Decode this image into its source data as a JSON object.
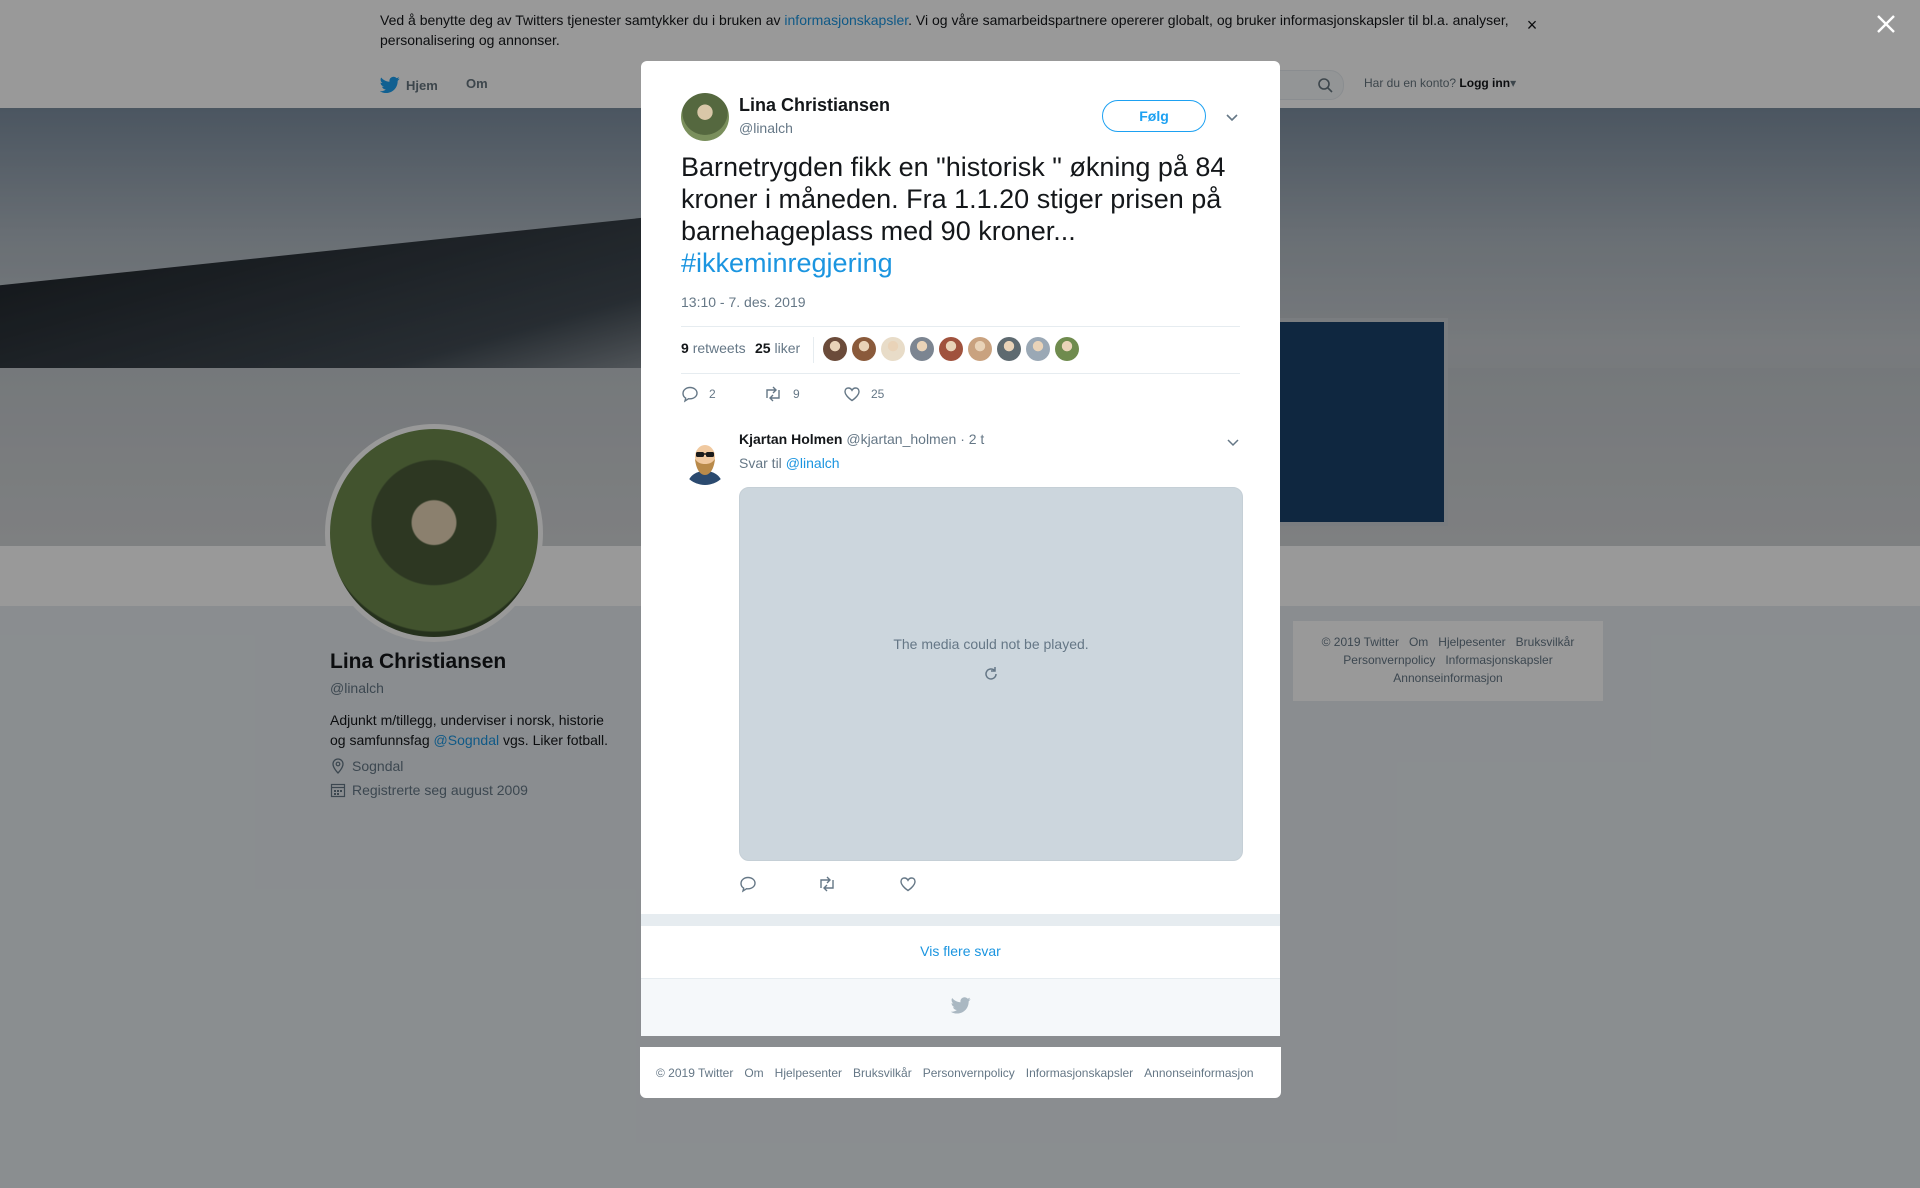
{
  "cookie_bar": {
    "text_before": "Ved å benytte deg av Twitters tjenester samtykker du i bruken av ",
    "link": "informasjonskapsler",
    "text_after": ". Vi og våre samarbeidspartnere opererer globalt, og bruker informasjonskapsler til bl.a. analyser, personalisering og annonser.",
    "close": "×"
  },
  "topnav": {
    "home": "Hjem",
    "about": "Om",
    "account_question": "Har du en konto?",
    "login": "Logg inn"
  },
  "profile": {
    "name": "Lina Christiansen",
    "handle": "@linalch",
    "bio_before": "Adjunkt m/tillegg, underviser i norsk, historie og samfunnsfag ",
    "bio_link": "@Sogndal",
    "bio_after": " vgs. Liker fotball.",
    "location": "Sogndal",
    "joined": "Registrerte seg august 2009"
  },
  "side_footer": {
    "links": [
      "© 2019 Twitter",
      "Om",
      "Hjelpesenter",
      "Bruksvilkår",
      "Personvernpolicy",
      "Informasjonskapsler",
      "Annonseinformasjon"
    ]
  },
  "tweet": {
    "author_name": "Lina Christiansen",
    "author_handle": "@linalch",
    "follow_label": "Følg",
    "text": "Barnetrygden fikk en \"historisk \" økning på 84 kroner i måneden. Fra 1.1.20 stiger prisen på barnehageplass med 90 kroner...",
    "hashtag": "#ikkeminregjering",
    "timestamp": "13:10 - 7. des. 2019",
    "retweets_count": "9",
    "retweets_label": "retweets",
    "likes_count": "25",
    "likes_label": "liker",
    "liker_colors": [
      "#6b4b3a",
      "#8a5a3b",
      "#e8dcc8",
      "#7c8591",
      "#a0523d",
      "#c9a27f",
      "#5e6a70",
      "#9aa8b5",
      "#6f8b4e"
    ],
    "actions": {
      "replies": "2",
      "retweets": "9",
      "likes": "25"
    }
  },
  "reply": {
    "name": "Kjartan Holmen",
    "handle": "@kjartan_holmen",
    "age": "· 2 t",
    "reply_to_label": "Svar til",
    "reply_to_handle": "@linalch",
    "media_message": "The media could not be played."
  },
  "more_replies": "Vis flere svar",
  "modal_footer": {
    "links": [
      "© 2019 Twitter",
      "Om",
      "Hjelpesenter",
      "Bruksvilkår",
      "Personvernpolicy",
      "Informasjonskapsler",
      "Annonseinformasjon"
    ]
  },
  "colors": {
    "accent": "#1da1f2",
    "link": "#1b95e0",
    "secondary_text": "#657786",
    "overlay": "rgba(0,0,0,0.40)"
  }
}
